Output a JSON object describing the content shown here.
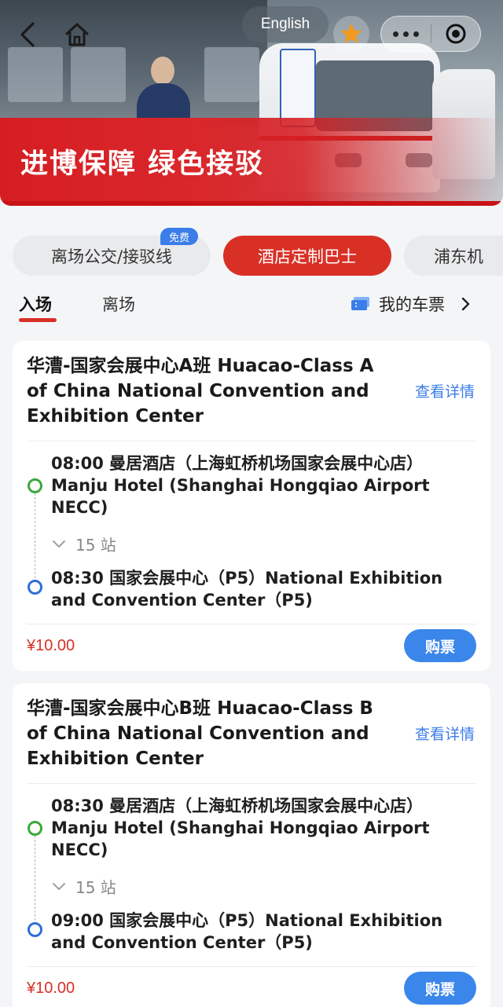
{
  "banner": {
    "title": "进博保障 绿色接驳"
  },
  "header": {
    "language_label": "English"
  },
  "categories": [
    {
      "label": "离场公交/接驳线",
      "badge": "免费",
      "active": false
    },
    {
      "label": "酒店定制巴士",
      "active": true
    },
    {
      "label": "浦东机",
      "active": false
    }
  ],
  "tabs": [
    {
      "label": "入场",
      "active": true
    },
    {
      "label": "离场",
      "active": false
    }
  ],
  "my_tickets_label": "我的车票",
  "colors": {
    "accent_red": "#d93026",
    "accent_blue": "#3b7de9",
    "start_dot": "#3aa93a",
    "end_dot": "#2f6ed8"
  },
  "routes": [
    {
      "title": "华漕-国家会展中心A班 Huacao-Class A of China National Convention and Exhibition Center",
      "detail_label": "查看详情",
      "start_stop": "08:00 曼居酒店（上海虹桥机场国家会展中心店）Manju Hotel (Shanghai Hongqiao Airport NECC)",
      "stops_count": "15 站",
      "end_stop": "08:30 国家会展中心（P5）National Exhibition and Convention Center（P5)",
      "price": "¥10.00",
      "buy_label": "购票"
    },
    {
      "title": "华漕-国家会展中心B班 Huacao-Class B of China National Convention and Exhibition Center",
      "detail_label": "查看详情",
      "start_stop": "08:30 曼居酒店（上海虹桥机场国家会展中心店）Manju Hotel (Shanghai Hongqiao Airport NECC)",
      "stops_count": "15 站",
      "end_stop": "09:00 国家会展中心（P5）National Exhibition and Convention Center（P5)",
      "price": "¥10.00",
      "buy_label": "购票"
    }
  ]
}
